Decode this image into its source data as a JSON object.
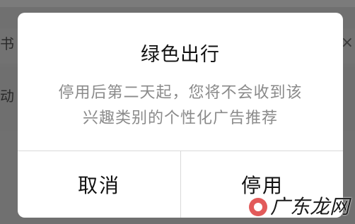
{
  "background": {
    "left_text_1": "书",
    "left_text_2": "动",
    "close_glyph": "×"
  },
  "dialog": {
    "title": "绿色出行",
    "message_line_1": "停用后第二天起，您将不会收到该",
    "message_line_2": "兴趣类别的个性化广告推荐",
    "cancel_label": "取消",
    "confirm_label": "停用"
  },
  "watermark": {
    "text": "广东龙网",
    "icon": "logo-icon"
  },
  "colors": {
    "overlay": "#707070",
    "dialog_bg": "#ffffff",
    "title": "#111111",
    "message": "#8a8a8a",
    "divider": "#d9d9d9"
  }
}
